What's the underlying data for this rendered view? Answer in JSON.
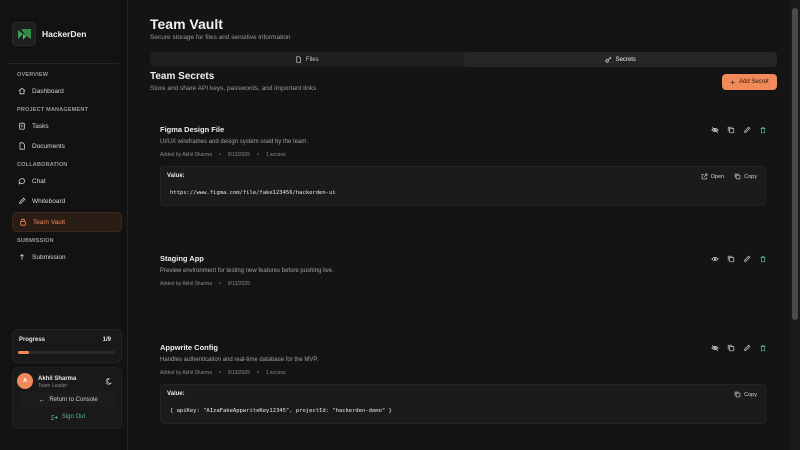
{
  "brand": {
    "name": "HackerDen"
  },
  "sidebar": {
    "sections": [
      {
        "title": "OVERVIEW"
      },
      {
        "title": "PROJECT MANAGEMENT"
      },
      {
        "title": "COLLABORATION"
      },
      {
        "title": "SUBMISSION"
      }
    ],
    "items": [
      {
        "label": "Dashboard",
        "icon": "home-icon"
      },
      {
        "label": "Tasks",
        "icon": "clipboard-icon"
      },
      {
        "label": "Documents",
        "icon": "document-icon"
      },
      {
        "label": "Chat",
        "icon": "chat-icon"
      },
      {
        "label": "Whiteboard",
        "icon": "pencil-icon"
      },
      {
        "label": "Team Vault",
        "icon": "lock-icon",
        "active": true
      },
      {
        "label": "Submission",
        "icon": "upload-icon"
      }
    ]
  },
  "progress": {
    "label": "Progress",
    "count": "1/9",
    "fraction": 0.111
  },
  "user": {
    "initial": "A",
    "name": "Akhil Sharma",
    "role": "Team Leader",
    "return_label": "Return to Console",
    "signout_label": "Sign Out"
  },
  "header": {
    "title": "Team Vault",
    "subtitle": "Secure storage for files and sensitive information"
  },
  "tabs": [
    {
      "label": "Files",
      "active": false
    },
    {
      "label": "Secrets",
      "active": true
    }
  ],
  "secrets_section": {
    "title": "Team Secrets",
    "subtitle": "Store and share API keys, passwords, and important links",
    "add_label": "Add Secret"
  },
  "secrets": [
    {
      "name": "Figma Design File",
      "description": "UI/UX wireframes and design system used by the team.",
      "added_by": "Added by Akhil Sharma",
      "date": "9/13/2025",
      "access": "1 access",
      "value_label": "Value:",
      "value": "https://www.figma.com/file/fake123456/hackerden-ui",
      "open_label": "Open",
      "copy_label": "Copy"
    },
    {
      "name": "Staging App",
      "description": "Preview environment for testing new features before pushing live.",
      "added_by": "Added by Akhil Sharma",
      "date": "9/13/2025"
    },
    {
      "name": "Appwrite Config",
      "description": "Handles authentication and real-time database for the MVP.",
      "added_by": "Added by Akhil Sharma",
      "date": "9/13/2025",
      "access": "1 access",
      "value_label": "Value:",
      "value": "{ apiKey: \"AIzaFakeAppwriteKey12345\", projectId: \"hackerden-demo\" }",
      "copy_label": "Copy"
    }
  ],
  "colors": {
    "background": "#141414",
    "accent": "#f08a5a",
    "delete": "#5ab49a"
  }
}
